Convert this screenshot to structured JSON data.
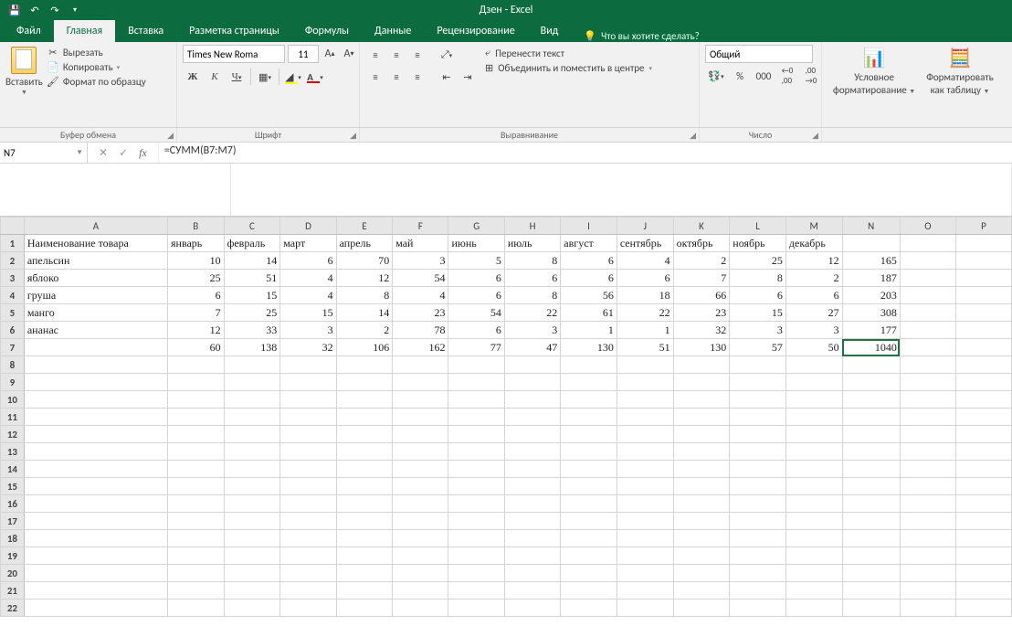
{
  "app": {
    "title": "Дзен - Excel"
  },
  "tabs": {
    "file": "Файл",
    "home": "Главная",
    "insert": "Вставка",
    "layout": "Разметка страницы",
    "formulas": "Формулы",
    "data": "Данные",
    "review": "Рецензирование",
    "view": "Вид",
    "tellme": "Что вы хотите сделать?"
  },
  "ribbon": {
    "paste": "Вставить",
    "cut": "Вырезать",
    "copy": "Копировать",
    "formatPainter": "Формат по образцу",
    "clipboard": "Буфер обмена",
    "font": "Шрифт",
    "fontName": "Times New Roma",
    "fontSize": "11",
    "alignment": "Выравнивание",
    "wrap": "Перенести текст",
    "merge": "Объединить и поместить в центре",
    "number": "Число",
    "numberFormat": "Общий",
    "condFmt": "Условное",
    "condFmt2": "форматирование",
    "tableFmt": "Форматировать",
    "tableFmt2": "как таблицу"
  },
  "nameBox": "N7",
  "formula": "=СУММ(B7:M7)",
  "columns": [
    "A",
    "B",
    "C",
    "D",
    "E",
    "F",
    "G",
    "H",
    "I",
    "J",
    "K",
    "L",
    "M",
    "N",
    "O",
    "P"
  ],
  "headerRow": [
    "Наименование товара",
    "январь",
    "февраль",
    "март",
    "апрель",
    "май",
    "июнь",
    "июль",
    "август",
    "сентябрь",
    "октябрь",
    "ноябрь",
    "декабрь",
    "",
    ""
  ],
  "data": [
    [
      "апельсин",
      "10",
      "14",
      "6",
      "70",
      "3",
      "5",
      "8",
      "6",
      "4",
      "2",
      "25",
      "12",
      "165",
      ""
    ],
    [
      "яблоко",
      "25",
      "51",
      "4",
      "12",
      "54",
      "6",
      "6",
      "6",
      "6",
      "7",
      "8",
      "2",
      "187",
      ""
    ],
    [
      "груша",
      "6",
      "15",
      "4",
      "8",
      "4",
      "6",
      "8",
      "56",
      "18",
      "66",
      "6",
      "6",
      "203",
      ""
    ],
    [
      "манго",
      "7",
      "25",
      "15",
      "14",
      "23",
      "54",
      "22",
      "61",
      "22",
      "23",
      "15",
      "27",
      "308",
      ""
    ],
    [
      "ананас",
      "12",
      "33",
      "3",
      "2",
      "78",
      "6",
      "3",
      "1",
      "1",
      "32",
      "3",
      "3",
      "177",
      ""
    ],
    [
      "",
      "60",
      "138",
      "32",
      "106",
      "162",
      "77",
      "47",
      "130",
      "51",
      "130",
      "57",
      "50",
      "1040",
      ""
    ]
  ],
  "activeCell": "N7",
  "groupWidths": {
    "clipboard": 194,
    "font": 200,
    "align": 372,
    "number": 134,
    "styles": 208
  }
}
